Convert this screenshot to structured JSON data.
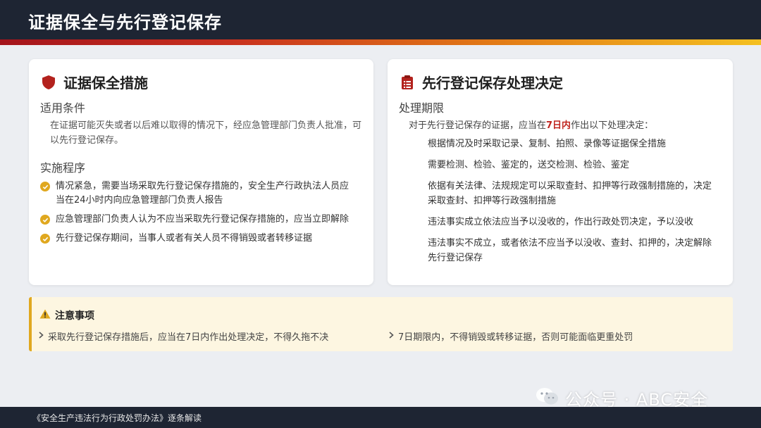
{
  "header": {
    "title": "证据保全与先行登记保存"
  },
  "left_card": {
    "icon": "shield-icon",
    "title": "证据保全措施",
    "conditions": {
      "heading": "适用条件",
      "text": "在证据可能灭失或者以后难以取得的情况下，经应急管理部门负责人批准，可以先行登记保存。"
    },
    "procedure": {
      "heading": "实施程序",
      "items": [
        "情况紧急，需要当场采取先行登记保存措施的，安全生产行政执法人员应当在24小时内向应急管理部门负责人报告",
        "应急管理部门负责人认为不应当采取先行登记保存措施的，应当立即解除",
        "先行登记保存期间，当事人或者有关人员不得销毁或者转移证据"
      ]
    }
  },
  "right_card": {
    "icon": "clipboard-icon",
    "title": "先行登记保存处理决定",
    "heading": "处理期限",
    "intro_before": "对于先行登记保存的证据，应当在",
    "intro_highlight": "7日内",
    "intro_after": "作出以下处理决定：",
    "items": [
      "根据情况及时采取记录、复制、拍照、录像等证据保全措施",
      "需要检测、检验、鉴定的，送交检测、检验、鉴定",
      "依据有关法律、法规规定可以采取查封、扣押等行政强制措施的，决定采取查封、扣押等行政强制措施",
      "违法事实成立依法应当予以没收的，作出行政处罚决定，予以没收",
      "违法事实不成立，或者依法不应当予以没收、查封、扣押的，决定解除先行登记保存"
    ]
  },
  "notice": {
    "icon": "warning-icon",
    "title": "注意事项",
    "items": [
      "采取先行登记保存措施后，应当在7日内作出处理决定，不得久拖不决",
      "7日期限内，不得销毁或转移证据，否则可能面临更重处罚"
    ]
  },
  "watermark": {
    "icon": "wechat-icon",
    "text": "公众号 · ABC安全"
  },
  "footer": {
    "text": "《安全生产违法行为行政处罚办法》逐条解读"
  },
  "colors": {
    "header_bg": "#1e2533",
    "accent_red": "#b3221d",
    "accent_gold": "#e0a81f",
    "notice_bg": "#fdf6e1",
    "highlight_red": "#c0261f"
  }
}
